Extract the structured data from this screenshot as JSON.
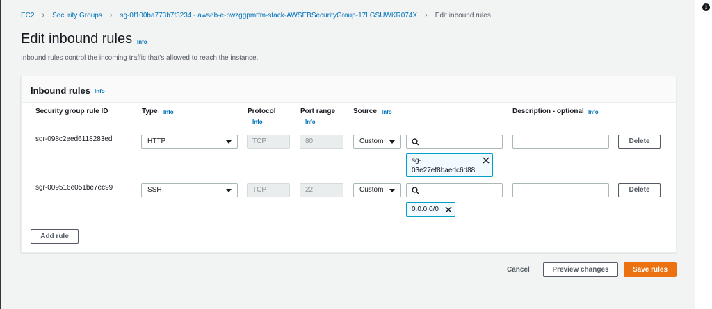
{
  "breadcrumb": {
    "items": [
      "EC2",
      "Security Groups",
      "sg-0f100ba773b7f3234 - awseb-e-pwzggpmtfm-stack-AWSEBSecurityGroup-17LGSUWKR074X"
    ],
    "current": "Edit inbound rules"
  },
  "help_icon": "i",
  "page": {
    "title": "Edit inbound rules",
    "info": "Info",
    "description": "Inbound rules control the incoming traffic that's allowed to reach the instance."
  },
  "panel": {
    "title": "Inbound rules",
    "info": "Info",
    "columns": {
      "rule_id": "Security group rule ID",
      "type": "Type",
      "protocol": "Protocol",
      "port_range": "Port range",
      "source": "Source",
      "description": "Description - optional",
      "info": "Info"
    },
    "rules": [
      {
        "id": "sgr-098c2eed6118283ed",
        "type": "HTTP",
        "protocol": "TCP",
        "port_range": "80",
        "source_type": "Custom",
        "source_search": "",
        "source_token_line1": "sg-",
        "source_token_line2": "03e27ef8baedc6d88",
        "description": "",
        "delete_label": "Delete"
      },
      {
        "id": "sgr-009516e051be7ec99",
        "type": "SSH",
        "protocol": "TCP",
        "port_range": "22",
        "source_type": "Custom",
        "source_search": "",
        "source_token": "0.0.0.0/0",
        "description": "",
        "delete_label": "Delete"
      }
    ],
    "add_rule_label": "Add rule"
  },
  "footer": {
    "cancel_label": "Cancel",
    "preview_label": "Preview changes",
    "save_label": "Save rules"
  },
  "colors": {
    "link": "#0073bb",
    "primary_button": "#ec7211",
    "token_border": "#00a1c9"
  }
}
